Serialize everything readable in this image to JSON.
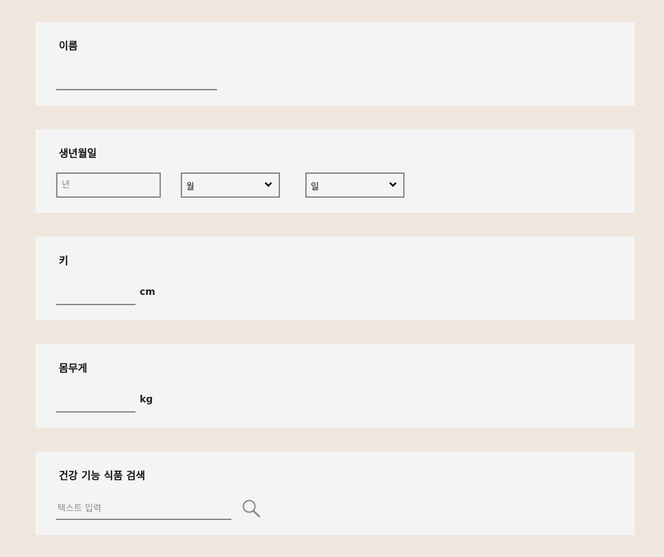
{
  "name_section": {
    "label": "이름",
    "value": ""
  },
  "birth_section": {
    "label": "생년월일",
    "year_placeholder": "년",
    "month_value": "월",
    "day_value": "일"
  },
  "height_section": {
    "label": "키",
    "value": "",
    "unit": "cm"
  },
  "weight_section": {
    "label": "몸무게",
    "value": "",
    "unit": "kg"
  },
  "supplement_search": {
    "label": "건강 기능 식품 검색",
    "placeholder": "텍스트 입력",
    "icon": "search-icon"
  },
  "colors": {
    "page_background": "#efe7de",
    "card_background": "#f4f4f4",
    "border": "#8a8a8a"
  }
}
